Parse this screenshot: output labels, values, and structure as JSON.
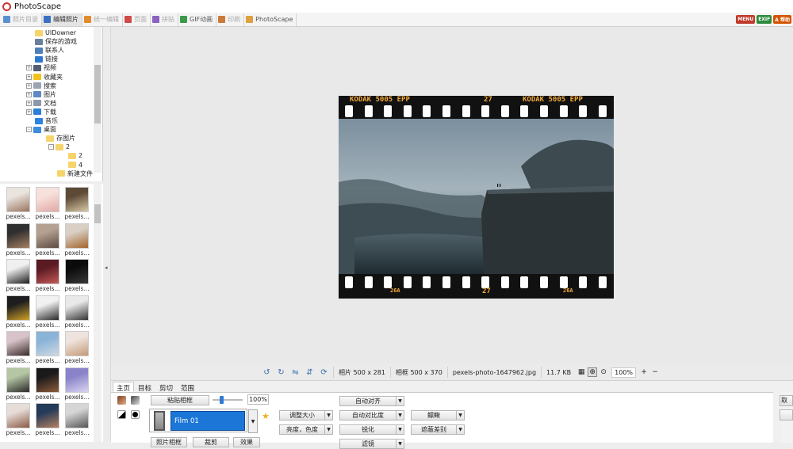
{
  "window": {
    "title": "PhotoScape"
  },
  "tabs": [
    {
      "label": "照片目录",
      "color": "#5a8fd0",
      "active": false
    },
    {
      "label": "编辑照片",
      "color": "#3b6fc4",
      "active": true
    },
    {
      "label": "统一编辑",
      "color": "#e28b2d",
      "active": false
    },
    {
      "label": "页面",
      "color": "#d04a4a",
      "active": false
    },
    {
      "label": "拼贴",
      "color": "#8a62c0",
      "active": false
    },
    {
      "label": "GIF动画",
      "color": "#3a9a4a",
      "active": false
    },
    {
      "label": "印刷",
      "color": "#c97a3a",
      "active": false
    },
    {
      "label": "PhotoScape",
      "color": "#e0a040",
      "active": false
    }
  ],
  "top_buttons": [
    {
      "label": "MENU",
      "color": "#c0392b"
    },
    {
      "label": "EXIF",
      "color": "#2e8b3e"
    },
    {
      "label": "A 帮助",
      "color": "#d35400"
    }
  ],
  "tree": {
    "items": [
      {
        "label": "UIDowner",
        "icon": "folder-icon",
        "color": "#f5d46b",
        "indent": 44,
        "expander": ""
      },
      {
        "label": "保存的游戏",
        "icon": "saved-games-icon",
        "color": "#6a7f9e",
        "indent": 44,
        "expander": ""
      },
      {
        "label": "联系人",
        "icon": "contacts-icon",
        "color": "#4d7fb8",
        "indent": 44,
        "expander": ""
      },
      {
        "label": "链接",
        "icon": "link-icon",
        "color": "#2c78d0",
        "indent": 44,
        "expander": ""
      },
      {
        "label": "视频",
        "icon": "video-icon",
        "color": "#555f73",
        "indent": 44,
        "expander": "+"
      },
      {
        "label": "收藏夹",
        "icon": "favorites-icon",
        "color": "#f2c31a",
        "indent": 44,
        "expander": "+"
      },
      {
        "label": "搜索",
        "icon": "search-icon",
        "color": "#9aa4b2",
        "indent": 44,
        "expander": "+"
      },
      {
        "label": "图片",
        "icon": "pictures-icon",
        "color": "#5e89c4",
        "indent": 44,
        "expander": "+"
      },
      {
        "label": "文档",
        "icon": "documents-icon",
        "color": "#8d99aa",
        "indent": 44,
        "expander": "+"
      },
      {
        "label": "下载",
        "icon": "download-icon",
        "color": "#2b7fd9",
        "indent": 44,
        "expander": "+"
      },
      {
        "label": "音乐",
        "icon": "music-icon",
        "color": "#2b84e0",
        "indent": 44,
        "expander": ""
      },
      {
        "label": "桌面",
        "icon": "desktop-icon",
        "color": "#3a8de0",
        "indent": 44,
        "expander": "-"
      },
      {
        "label": "存图片",
        "icon": "folder-icon",
        "color": "#f5d46b",
        "indent": 58,
        "expander": ""
      },
      {
        "label": "2",
        "icon": "folder-icon",
        "color": "#f5d46b",
        "indent": 72,
        "expander": "-"
      },
      {
        "label": "2",
        "icon": "folder-icon",
        "color": "#f5d46b",
        "indent": 86,
        "expander": ""
      },
      {
        "label": "4",
        "icon": "folder-icon",
        "color": "#f5d46b",
        "indent": 86,
        "expander": ""
      },
      {
        "label": "新建文件",
        "icon": "folder-icon",
        "color": "#f5d46b",
        "indent": 72,
        "expander": ""
      }
    ]
  },
  "thumbnails": {
    "label": "pexels...",
    "items": [
      {
        "name": "portrait-woman",
        "c1": "#e9e4de",
        "c2": "#9b7460"
      },
      {
        "name": "pink-hands",
        "c1": "#f7e1dc",
        "c2": "#e2a9a4"
      },
      {
        "name": "man-dark",
        "c1": "#5d4a36",
        "c2": "#d8c9a5"
      },
      {
        "name": "bearded-man",
        "c1": "#2f2f2f",
        "c2": "#a57f61"
      },
      {
        "name": "couple",
        "c1": "#b5a192",
        "c2": "#5c4a40"
      },
      {
        "name": "dog-brown",
        "c1": "#d9cfc4",
        "c2": "#a3642c"
      },
      {
        "name": "silhouette-head",
        "c1": "#f0f0f0",
        "c2": "#1d1d1d"
      },
      {
        "name": "girl-red",
        "c1": "#5b1a22",
        "c2": "#c45a5a"
      },
      {
        "name": "dark-portrait",
        "c1": "#0b0b0b",
        "c2": "#3a3a3a"
      },
      {
        "name": "yellow-jacket",
        "c1": "#1e1e1e",
        "c2": "#cfa128"
      },
      {
        "name": "husky-dog",
        "c1": "#f1f1f1",
        "c2": "#2a2a2a"
      },
      {
        "name": "puppy-bw",
        "c1": "#e9e9e9",
        "c2": "#333333"
      },
      {
        "name": "woman-long-hair",
        "c1": "#d7c3c8",
        "c2": "#3a2a2a"
      },
      {
        "name": "street-crowd",
        "c1": "#8ab3d8",
        "c2": "#cfd9e2"
      },
      {
        "name": "woman-blonde",
        "c1": "#eee4dd",
        "c2": "#c69978"
      },
      {
        "name": "man-suit",
        "c1": "#b5c6a3",
        "c2": "#2a2a2a"
      },
      {
        "name": "couple-dark",
        "c1": "#1a1a1a",
        "c2": "#8b5c3a"
      },
      {
        "name": "purple-landscape",
        "c1": "#8a83c9",
        "c2": "#d9d4f0"
      },
      {
        "name": "woman-portrait",
        "c1": "#e7ddd8",
        "c2": "#8b5a44"
      },
      {
        "name": "man-blue-shirt",
        "c1": "#233a58",
        "c2": "#b57f60"
      },
      {
        "name": "grey-cat",
        "c1": "#d6d6d6",
        "c2": "#555555"
      }
    ]
  },
  "photo": {
    "film_top_left": "KODAK 5005 EPP",
    "film_top_mid": "27",
    "film_top_right": "KODAK 5005 EPP",
    "film_bottom_left": "26A",
    "film_bottom_mid": "27",
    "film_bottom_right": "26A"
  },
  "status": {
    "photo_size": "相片 500 x 281",
    "frame_size": "相框 500 x 370",
    "filename": "pexels-photo-1647962.jpg",
    "filesize": "11.7 KB",
    "zoom": "100%"
  },
  "bottom": {
    "tabs": [
      "主页",
      "目标",
      "剪切",
      "范围"
    ],
    "paste_frame": "粘贴相框",
    "frame_percent": "100%",
    "frame_name": "Film 01",
    "buttons": {
      "resize": "调整大小",
      "brightness": "亮度，色度",
      "auto_level": "自动对齐",
      "auto_contrast": "自动对比度",
      "sharpen": "锐化",
      "filter": "滤镜",
      "bloom": "鳔鳅",
      "backlight": "遮蔽差别",
      "photo_frame": "照片相框",
      "clip": "裁剪",
      "effect": "效果",
      "right_edge": "取"
    }
  }
}
